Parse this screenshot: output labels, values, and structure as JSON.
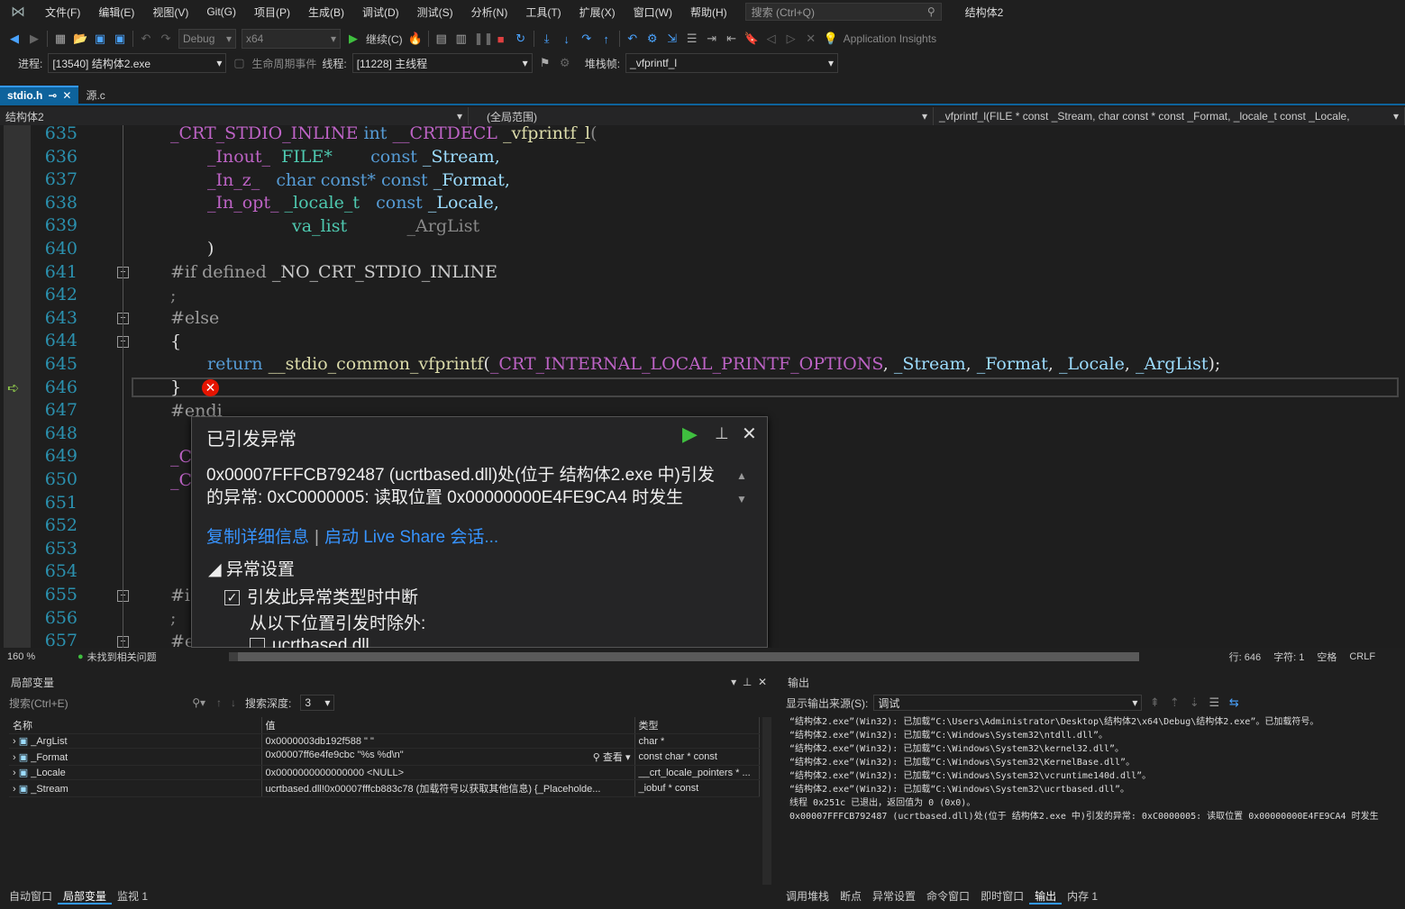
{
  "menu": [
    "文件(F)",
    "编辑(E)",
    "视图(V)",
    "Git(G)",
    "项目(P)",
    "生成(B)",
    "调试(D)",
    "测试(S)",
    "分析(N)",
    "工具(T)",
    "扩展(X)",
    "窗口(W)",
    "帮助(H)"
  ],
  "search_placeholder": "搜索 (Ctrl+Q)",
  "app_title": "结构体2",
  "toolbar": {
    "config": "Debug",
    "platform": "x64",
    "continue_label": "继续(C)",
    "app_insights": "Application Insights"
  },
  "debugbar": {
    "process_label": "进程:",
    "process_value": "[13540] 结构体2.exe",
    "lifecycle_label": "生命周期事件",
    "thread_label": "线程:",
    "thread_value": "[11228] 主线程",
    "stack_label": "堆栈帧:",
    "stack_value": "_vfprintf_l"
  },
  "tabs": [
    {
      "label": "stdio.h",
      "active": true
    },
    {
      "label": "源.c",
      "active": false
    }
  ],
  "navbar": {
    "project": "结构体2",
    "scope": "(全局范围)",
    "member": "_vfprintf_l(FILE * const _Stream, char const * const _Format, _locale_t const _Locale,"
  },
  "line_numbers": [
    "635",
    "636",
    "637",
    "638",
    "639",
    "640",
    "641",
    "642",
    "643",
    "644",
    "645",
    "646",
    "647",
    "648",
    "649",
    "650",
    "651",
    "652",
    "653",
    "654",
    "655",
    "656",
    "657"
  ],
  "code": {
    "l635_a": "_CRT_STDIO_INLINE",
    "l635_b": "int",
    "l635_c": "__CRTDECL",
    "l635_d": "_vfprintf_l",
    "l636_a": "_Inout_",
    "l636_b": "FILE*",
    "l636_c": "const",
    "l636_d": "_Stream,",
    "l637_a": "_In_z_",
    "l637_b": "char const*",
    "l637_c": "const",
    "l637_d": "_Format,",
    "l638_a": "_In_opt_",
    "l638_b": "_locale_t",
    "l638_c": "const",
    "l638_d": "_Locale,",
    "l639_a": "va_list",
    "l639_b": "_ArgList",
    "l640": ")",
    "l641_a": "#if defined",
    "l641_b": "_NO_CRT_STDIO_INLINE",
    "l642": ";",
    "l643": "#else",
    "l644": "{",
    "l645_a": "return",
    "l645_b": "__stdio_common_vfprintf",
    "l645_c": "_CRT_INTERNAL_LOCAL_PRINTF_OPTIONS",
    "l645_d": "_Stream",
    "l645_e": "_Format",
    "l645_f": "_Locale",
    "l645_g": "_ArgList",
    "l646": "}",
    "l647": "#endi",
    "l649": "_Cl",
    "l650": "_Cl",
    "l655": "#i",
    "l656": ";",
    "l657": "#e"
  },
  "exception": {
    "title": "已引发异常",
    "message": "0x00007FFFCB792487 (ucrtbased.dll)处(位于 结构体2.exe 中)引发的异常: 0xC0000005: 读取位置 0x00000000E4FE9CA4 时发生",
    "copy_details": "复制详细信息",
    "live_share": "启动 Live Share 会话...",
    "settings_header": "异常设置",
    "break_when": "引发此异常类型时中断",
    "except_from": "从以下位置引发时除外:",
    "module": "ucrtbased.dll"
  },
  "status": {
    "zoom": "160 %",
    "issues": "未找到相关问题",
    "line": "行: 646",
    "char": "字符: 1",
    "space": "空格",
    "crlf": "CRLF"
  },
  "locals": {
    "title": "局部变量",
    "search": "搜索(Ctrl+E)",
    "depth_label": "搜索深度:",
    "depth": "3",
    "columns": [
      "名称",
      "值",
      "类型"
    ],
    "rows": [
      {
        "name": "_ArgList",
        "value": "0x0000003db192f588 \"       \"",
        "type": "char *"
      },
      {
        "name": "_Format",
        "value": "0x00007ff6e4fe9cbc \"%s %d\\n\"",
        "type": "const char * const",
        "view": "查看"
      },
      {
        "name": "_Locale",
        "value": "0x0000000000000000 <NULL>",
        "type": "__crt_locale_pointers * ..."
      },
      {
        "name": "_Stream",
        "value": "ucrtbased.dll!0x00007fffcb883c78 (加载符号以获取其他信息) {_Placeholde...",
        "type": "_iobuf * const"
      }
    ],
    "bottom_tabs": [
      "自动窗口",
      "局部变量",
      "监视 1"
    ]
  },
  "output": {
    "title": "输出",
    "source_label": "显示输出来源(S):",
    "source_value": "调试",
    "lines": [
      "“结构体2.exe”(Win32): 已加载“C:\\Users\\Administrator\\Desktop\\结构体2\\x64\\Debug\\结构体2.exe”。已加载符号。",
      "“结构体2.exe”(Win32): 已加载“C:\\Windows\\System32\\ntdll.dll”。",
      "“结构体2.exe”(Win32): 已加载“C:\\Windows\\System32\\kernel32.dll”。",
      "“结构体2.exe”(Win32): 已加载“C:\\Windows\\System32\\KernelBase.dll”。",
      "“结构体2.exe”(Win32): 已加载“C:\\Windows\\System32\\vcruntime140d.dll”。",
      "“结构体2.exe”(Win32): 已加载“C:\\Windows\\System32\\ucrtbased.dll”。",
      "线程 0x251c 已退出，返回值为 0 (0x0)。",
      "0x00007FFFCB792487 (ucrtbased.dll)处(位于 结构体2.exe 中)引发的异常: 0xC0000005: 读取位置 0x00000000E4FE9CA4 时发生"
    ],
    "bottom_tabs": [
      "调用堆栈",
      "断点",
      "异常设置",
      "命令窗口",
      "即时窗口",
      "输出",
      "内存 1"
    ]
  }
}
